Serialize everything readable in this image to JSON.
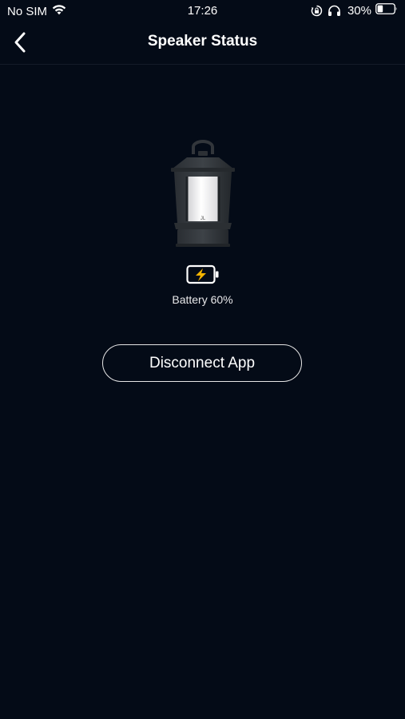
{
  "status_bar": {
    "carrier": "No SIM",
    "time": "17:26",
    "battery_percent": "30%",
    "icons": [
      "wifi-icon",
      "orientation-lock-icon",
      "headphones-icon",
      "battery-icon"
    ]
  },
  "nav": {
    "title": "Speaker Status",
    "back_icon": "chevron-left-icon"
  },
  "speaker": {
    "image": "lantern-speaker-image",
    "battery_icon": "battery-charging-icon",
    "battery_label": "Battery 60%",
    "battery_level": 0.6,
    "accent_color": "#f5b400"
  },
  "actions": {
    "disconnect_label": "Disconnect App"
  }
}
